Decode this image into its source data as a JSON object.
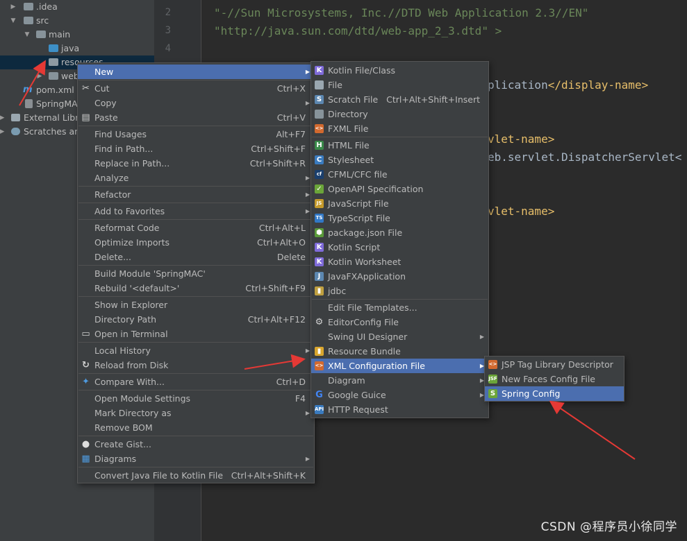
{
  "tree": {
    "items": [
      {
        "label": ".idea",
        "arrow": "▶"
      },
      {
        "label": "src",
        "arrow": "▼"
      },
      {
        "label": "main",
        "arrow": "▼"
      },
      {
        "label": "java",
        "arrow": ""
      },
      {
        "label": "resources",
        "arrow": ""
      },
      {
        "label": "web",
        "arrow": "▶"
      },
      {
        "label": "pom.xml",
        "arrow": ""
      },
      {
        "label": "SpringMAC",
        "arrow": ""
      },
      {
        "label": "External Libra",
        "arrow": "▶"
      },
      {
        "label": "Scratches and",
        "arrow": "▶"
      }
    ]
  },
  "editor": {
    "line_numbers": [
      "2",
      "3",
      "4"
    ],
    "lines": [
      "\"-//Sun Microsystems, Inc.//DTD Web Application 2.3//EN\"",
      "\"http://java.sun.com/dtd/web-app_2_3.dtd\" >",
      "plication",
      "</display-name>",
      "vlet-name>",
      "eb.servlet.DispatcherServlet<",
      "vlet-name>"
    ]
  },
  "context_menu": {
    "items": [
      {
        "label": "New",
        "shortcut": "",
        "sub": true,
        "icon": ""
      },
      {
        "label": "Cut",
        "shortcut": "Ctrl+X",
        "sub": false,
        "icon": "cut-icon"
      },
      {
        "label": "Copy",
        "shortcut": "",
        "sub": true,
        "icon": ""
      },
      {
        "label": "Paste",
        "shortcut": "Ctrl+V",
        "sub": false,
        "icon": "paste-icon"
      },
      {
        "label": "Find Usages",
        "shortcut": "Alt+F7",
        "sub": false,
        "icon": ""
      },
      {
        "label": "Find in Path...",
        "shortcut": "Ctrl+Shift+F",
        "sub": false,
        "icon": ""
      },
      {
        "label": "Replace in Path...",
        "shortcut": "Ctrl+Shift+R",
        "sub": false,
        "icon": ""
      },
      {
        "label": "Analyze",
        "shortcut": "",
        "sub": true,
        "icon": ""
      },
      {
        "label": "Refactor",
        "shortcut": "",
        "sub": true,
        "icon": ""
      },
      {
        "label": "Add to Favorites",
        "shortcut": "",
        "sub": true,
        "icon": ""
      },
      {
        "label": "Reformat Code",
        "shortcut": "Ctrl+Alt+L",
        "sub": false,
        "icon": ""
      },
      {
        "label": "Optimize Imports",
        "shortcut": "Ctrl+Alt+O",
        "sub": false,
        "icon": ""
      },
      {
        "label": "Delete...",
        "shortcut": "Delete",
        "sub": false,
        "icon": ""
      },
      {
        "label": "Build Module 'SpringMAC'",
        "shortcut": "",
        "sub": false,
        "icon": ""
      },
      {
        "label": "Rebuild '<default>'",
        "shortcut": "Ctrl+Shift+F9",
        "sub": false,
        "icon": ""
      },
      {
        "label": "Show in Explorer",
        "shortcut": "",
        "sub": false,
        "icon": ""
      },
      {
        "label": "Directory Path",
        "shortcut": "Ctrl+Alt+F12",
        "sub": false,
        "icon": ""
      },
      {
        "label": "Open in Terminal",
        "shortcut": "",
        "sub": false,
        "icon": "terminal-icon"
      },
      {
        "label": "Local History",
        "shortcut": "",
        "sub": true,
        "icon": ""
      },
      {
        "label": "Reload from Disk",
        "shortcut": "",
        "sub": false,
        "icon": "reload-icon"
      },
      {
        "label": "Compare With...",
        "shortcut": "Ctrl+D",
        "sub": false,
        "icon": "compare-icon"
      },
      {
        "label": "Open Module Settings",
        "shortcut": "F4",
        "sub": false,
        "icon": ""
      },
      {
        "label": "Mark Directory as",
        "shortcut": "",
        "sub": true,
        "icon": ""
      },
      {
        "label": "Remove BOM",
        "shortcut": "",
        "sub": false,
        "icon": ""
      },
      {
        "label": "Create Gist...",
        "shortcut": "",
        "sub": false,
        "icon": "github-icon"
      },
      {
        "label": "Diagrams",
        "shortcut": "",
        "sub": true,
        "icon": "diagrams-icon"
      },
      {
        "label": "Convert Java File to Kotlin File",
        "shortcut": "Ctrl+Alt+Shift+K",
        "sub": false,
        "icon": ""
      }
    ]
  },
  "new_menu": {
    "items": [
      {
        "label": "Kotlin File/Class",
        "shortcut": "",
        "sub": false,
        "icon": "kotlin-icon"
      },
      {
        "label": "File",
        "shortcut": "",
        "sub": false,
        "icon": "file-icon"
      },
      {
        "label": "Scratch File",
        "shortcut": "Ctrl+Alt+Shift+Insert",
        "sub": false,
        "icon": "scratch-icon"
      },
      {
        "label": "Directory",
        "shortcut": "",
        "sub": false,
        "icon": "folder-icon"
      },
      {
        "label": "FXML File",
        "shortcut": "",
        "sub": false,
        "icon": "fxml-icon"
      },
      {
        "label": "HTML File",
        "shortcut": "",
        "sub": false,
        "icon": "html-icon"
      },
      {
        "label": "Stylesheet",
        "shortcut": "",
        "sub": false,
        "icon": "css-icon"
      },
      {
        "label": "CFML/CFC file",
        "shortcut": "",
        "sub": false,
        "icon": "cfml-icon"
      },
      {
        "label": "OpenAPI Specification",
        "shortcut": "",
        "sub": false,
        "icon": "openapi-icon"
      },
      {
        "label": "JavaScript File",
        "shortcut": "",
        "sub": false,
        "icon": "javascript-icon"
      },
      {
        "label": "TypeScript File",
        "shortcut": "",
        "sub": false,
        "icon": "typescript-icon"
      },
      {
        "label": "package.json File",
        "shortcut": "",
        "sub": false,
        "icon": "nodejs-icon"
      },
      {
        "label": "Kotlin Script",
        "shortcut": "",
        "sub": false,
        "icon": "kotlin-script-icon"
      },
      {
        "label": "Kotlin Worksheet",
        "shortcut": "",
        "sub": false,
        "icon": "kotlin-worksheet-icon"
      },
      {
        "label": "JavaFXApplication",
        "shortcut": "",
        "sub": false,
        "icon": "javafx-icon"
      },
      {
        "label": "jdbc",
        "shortcut": "",
        "sub": false,
        "icon": "jdbc-icon"
      },
      {
        "label": "Edit File Templates...",
        "shortcut": "",
        "sub": false,
        "icon": ""
      },
      {
        "label": "EditorConfig File",
        "shortcut": "",
        "sub": false,
        "icon": "gear-icon"
      },
      {
        "label": "Swing UI Designer",
        "shortcut": "",
        "sub": true,
        "icon": ""
      },
      {
        "label": "Resource Bundle",
        "shortcut": "",
        "sub": false,
        "icon": "bundle-icon"
      },
      {
        "label": "XML Configuration File",
        "shortcut": "",
        "sub": true,
        "icon": "xml-icon"
      },
      {
        "label": "Diagram",
        "shortcut": "",
        "sub": true,
        "icon": ""
      },
      {
        "label": "Google Guice",
        "shortcut": "",
        "sub": true,
        "icon": "google-icon"
      },
      {
        "label": "HTTP Request",
        "shortcut": "",
        "sub": false,
        "icon": "api-icon"
      }
    ]
  },
  "xml_menu": {
    "items": [
      {
        "label": "JSP Tag Library Descriptor",
        "icon": "tld-icon"
      },
      {
        "label": "New Faces Config File",
        "icon": "jsf-icon"
      },
      {
        "label": "Spring Config",
        "icon": "spring-icon"
      }
    ]
  },
  "watermark": "CSDN @程序员小徐同学",
  "colors": {
    "menu_bg": "#3c3f41",
    "highlight": "#4b6eaf",
    "annotation": "#e53935"
  }
}
